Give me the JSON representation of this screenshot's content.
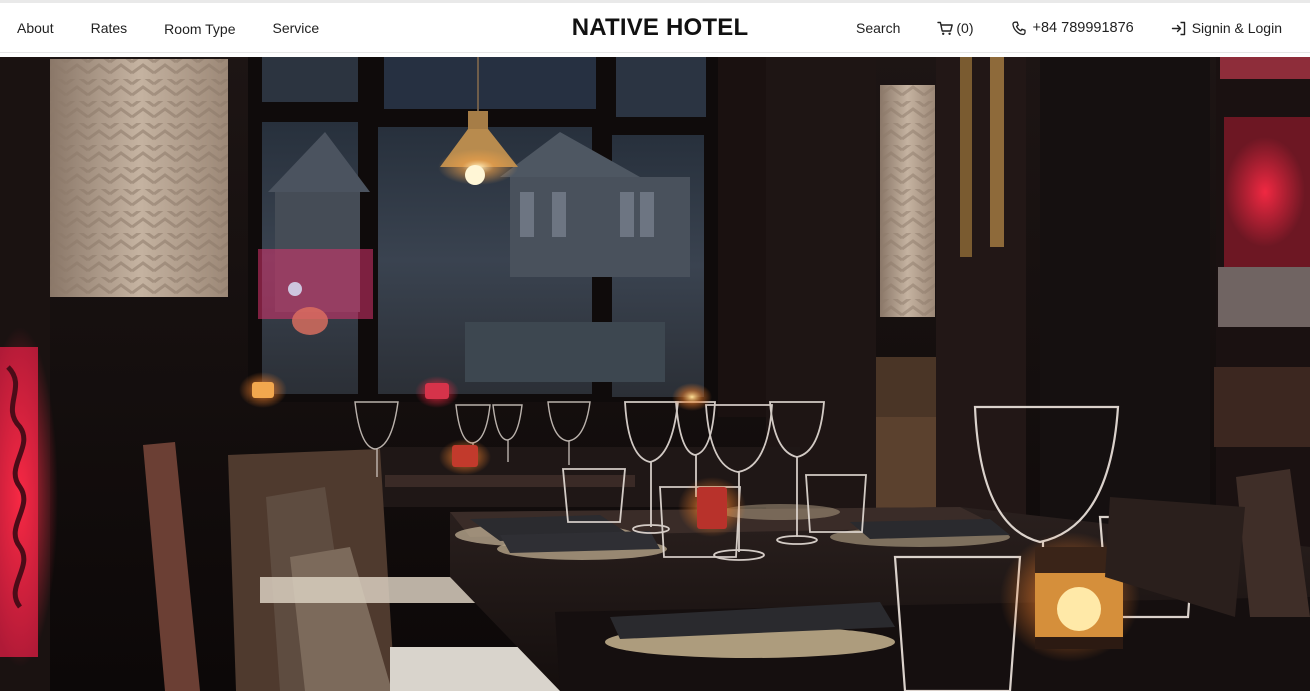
{
  "header": {
    "nav_left": [
      {
        "label": "About"
      },
      {
        "label": "Rates"
      },
      {
        "label": "Room Type"
      },
      {
        "label": "Service"
      }
    ],
    "brand": "NATIVE HOTEL",
    "search_label": "Search",
    "cart_label": "(0)",
    "phone_label": "+84 789991876",
    "signin_label": "Signin & Login"
  },
  "icons": {
    "cart": "cart-icon",
    "phone": "phone-icon",
    "signin": "login-arrow-icon"
  },
  "colors": {
    "text": "#222222",
    "brand": "#111111",
    "hero_dark": "#120c0c"
  }
}
